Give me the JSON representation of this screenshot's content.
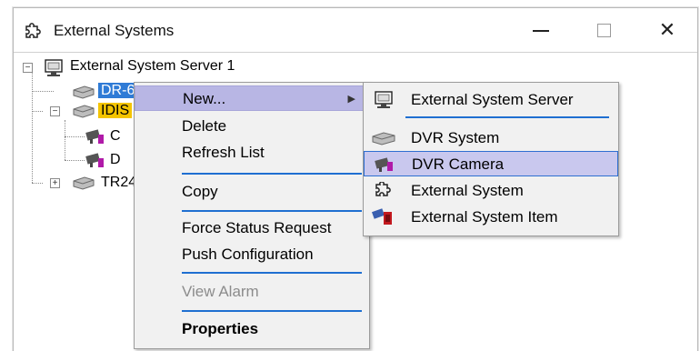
{
  "window": {
    "title": "External Systems",
    "title_icon": "puzzle-piece-icon",
    "minimize_icon": "minimize-icon",
    "maximize_icon": "maximize-icon",
    "close_glyph": "✕"
  },
  "tree": {
    "root": {
      "label": "External System Server 1",
      "expander": "−",
      "icon": "server-monitor-icon"
    },
    "nodes": [
      {
        "label": "DR-6000",
        "icon": "dvr-system-icon",
        "state": "selected"
      },
      {
        "label": "IDIS",
        "icon": "dvr-system-icon",
        "expander": "−",
        "state": "highlighted"
      },
      {
        "label": "C",
        "icon": "dvr-camera-icon"
      },
      {
        "label": "D",
        "icon": "dvr-camera-icon"
      },
      {
        "label": "TR24",
        "icon": "dvr-system-icon",
        "expander": "+"
      }
    ]
  },
  "context_menu": {
    "items": [
      {
        "label": "New...",
        "state": "highlighted",
        "submenu_arrow": "▶"
      },
      {
        "label": "Delete"
      },
      {
        "label": "Refresh List"
      },
      {
        "label": "Copy"
      },
      {
        "label": "Force Status Request"
      },
      {
        "label": "Push Configuration"
      },
      {
        "label": "View Alarm",
        "state": "disabled"
      },
      {
        "label": "Properties",
        "state": "bold"
      }
    ]
  },
  "submenu": {
    "items": [
      {
        "label": "External System Server",
        "icon": "server-monitor-icon"
      },
      {
        "label": "DVR System",
        "icon": "dvr-system-icon"
      },
      {
        "label": "DVR Camera",
        "icon": "dvr-camera-icon",
        "state": "highlighted"
      },
      {
        "label": "External System",
        "icon": "puzzle-piece-icon"
      },
      {
        "label": "External System Item",
        "icon": "external-system-item-icon"
      }
    ]
  },
  "colors": {
    "selection_blue": "#2f7bd6",
    "selection_yellow": "#f4c400",
    "menu_highlight": "#b8b6e4",
    "separator": "#1f6fd1",
    "camera_purple": "#b01aa8"
  }
}
